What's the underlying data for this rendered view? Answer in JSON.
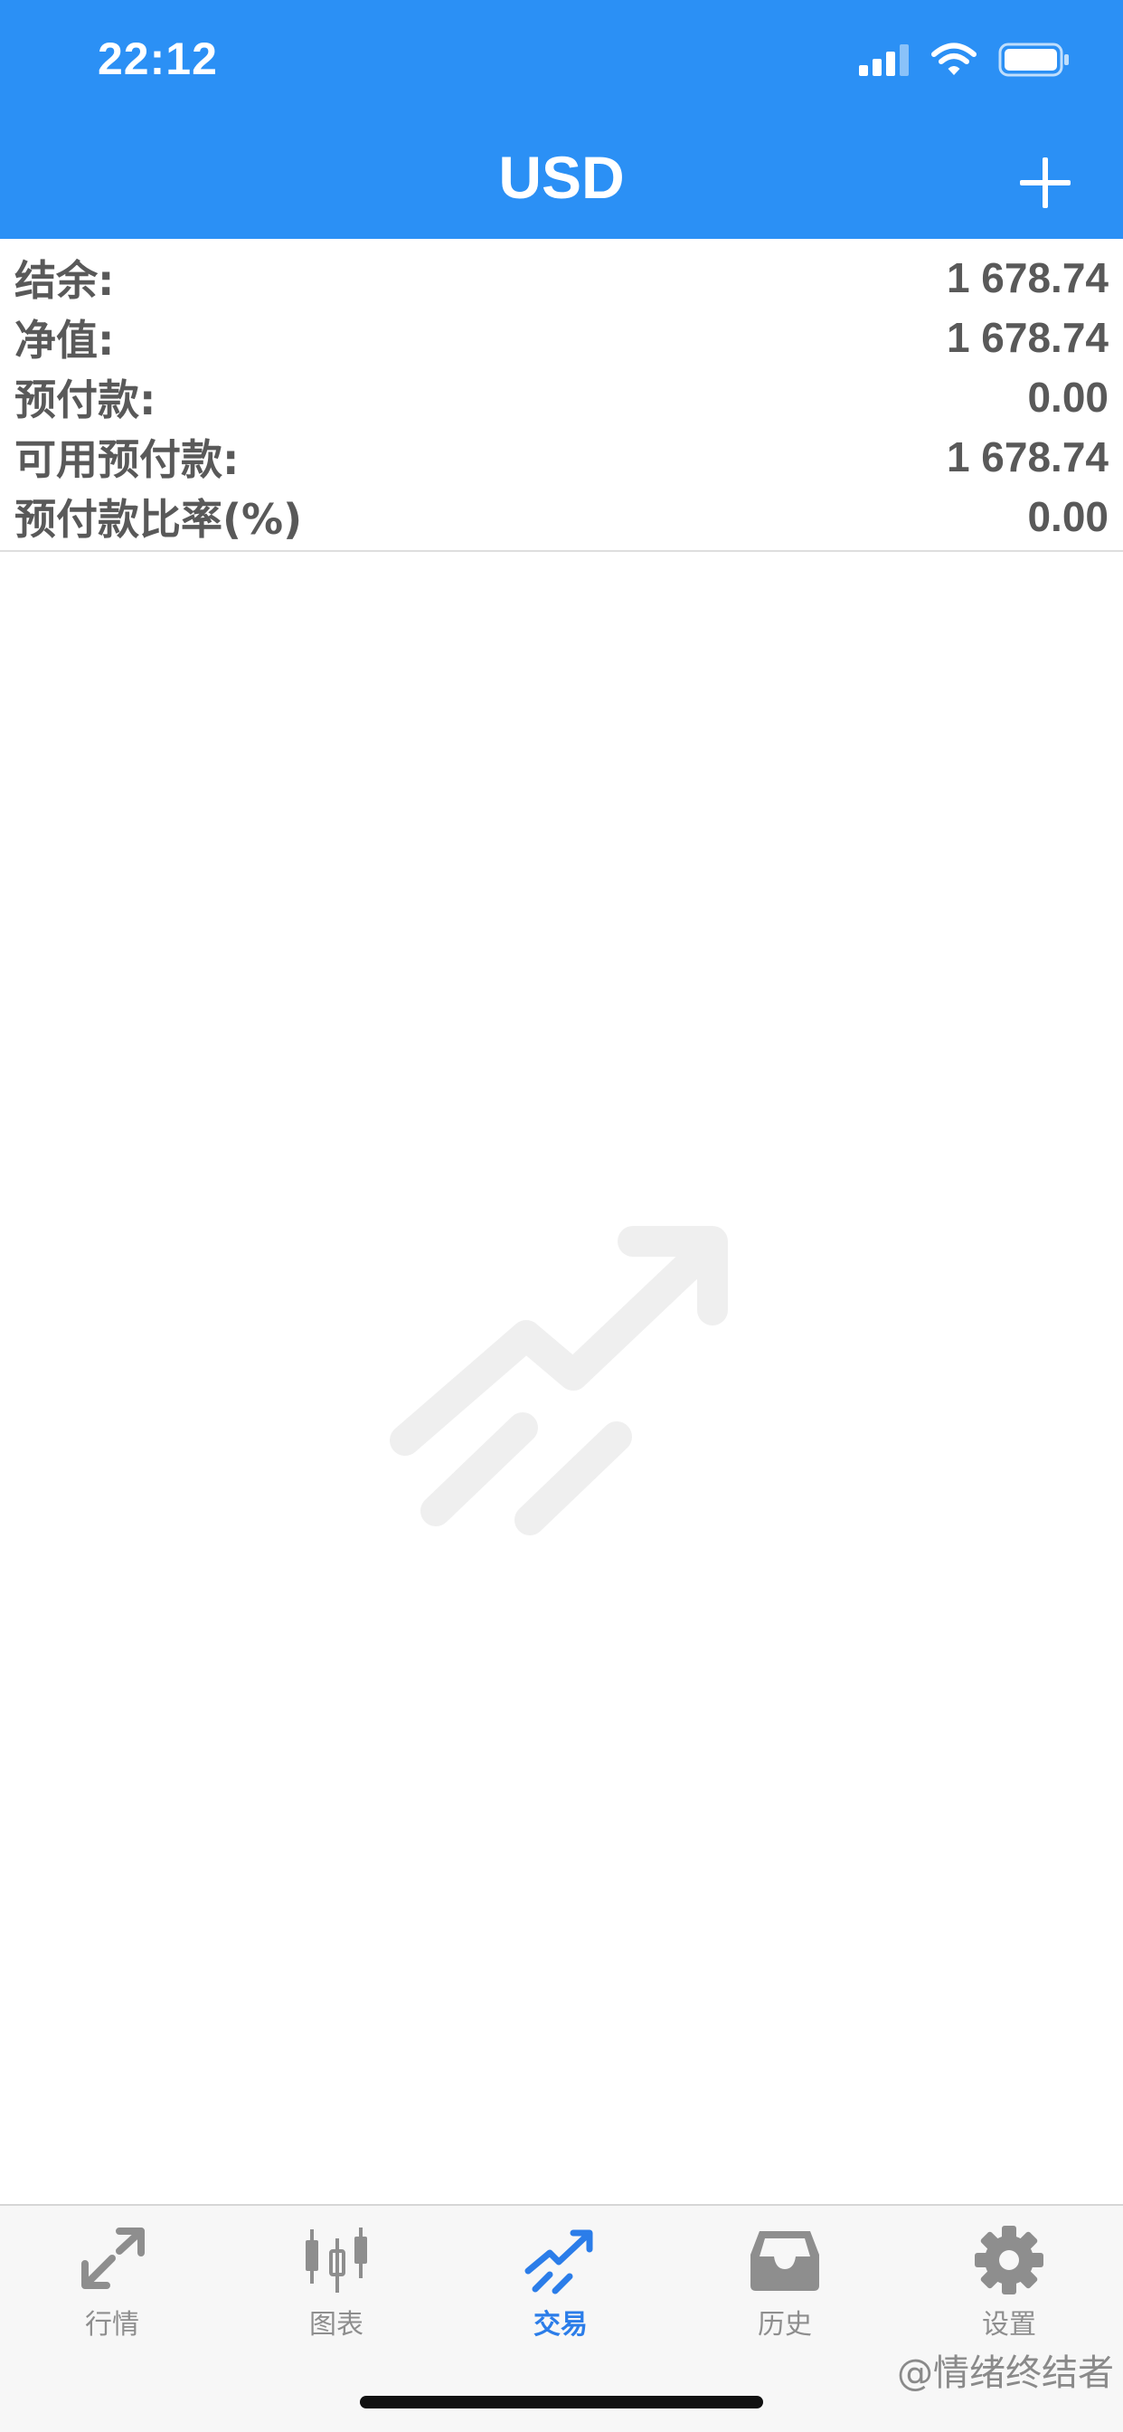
{
  "status_bar": {
    "time": "22:12"
  },
  "header": {
    "title": "USD"
  },
  "account": {
    "rows": [
      {
        "label": "结余:",
        "value": "1 678.74"
      },
      {
        "label": "净值:",
        "value": "1 678.74"
      },
      {
        "label": "预付款:",
        "value": "0.00"
      },
      {
        "label": "可用预付款:",
        "value": "1 678.74"
      },
      {
        "label": "预付款比率(%)",
        "value": "0.00"
      }
    ]
  },
  "tabs": [
    {
      "label": "行情",
      "icon": "quotes-arrows-icon"
    },
    {
      "label": "图表",
      "icon": "candlestick-chart-icon"
    },
    {
      "label": "交易",
      "icon": "trade-trend-icon",
      "active": true
    },
    {
      "label": "历史",
      "icon": "history-inbox-icon"
    },
    {
      "label": "设置",
      "icon": "gear-icon"
    }
  ],
  "colors": {
    "accent": "#2b90f5",
    "active_tab": "#2b7de9",
    "inactive_tab": "#8e8e8e"
  },
  "watermark": "@情绪终结者"
}
